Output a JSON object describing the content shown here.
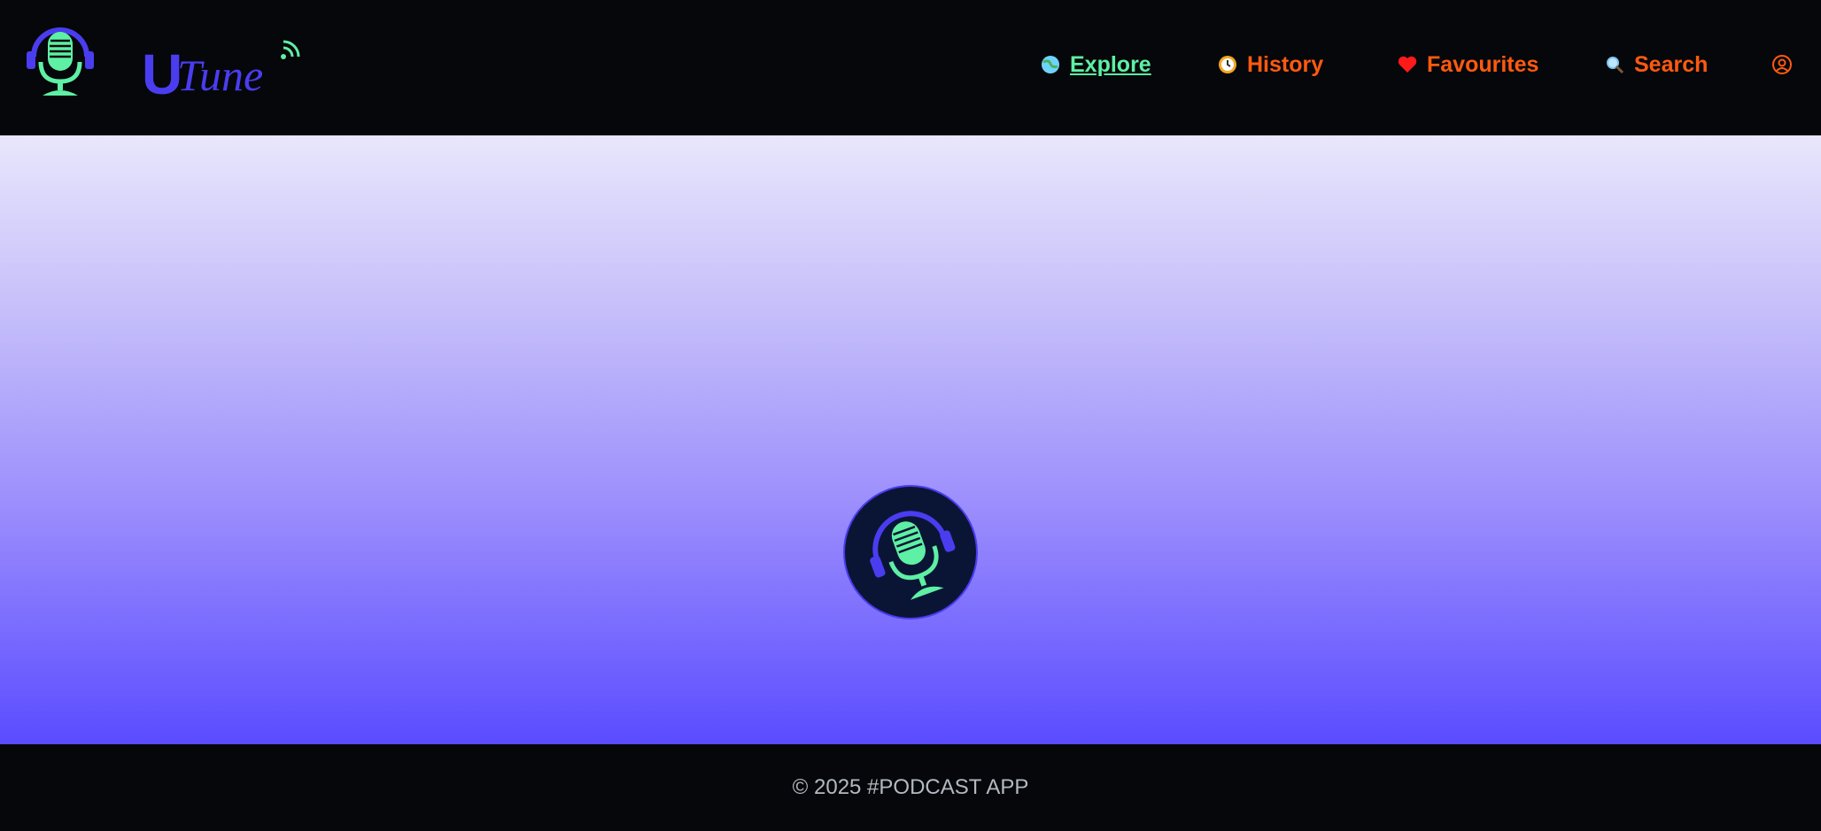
{
  "header": {
    "logo_icon": "podcast-mic-headphones-logo",
    "brand_icon": "utune-wordmark-logo",
    "brand_text": "UTune"
  },
  "nav": [
    {
      "label": "Explore",
      "icon": "globe-icon",
      "active": true,
      "color": "#5ef0a4"
    },
    {
      "label": "History",
      "icon": "clock-icon",
      "active": false,
      "color": "#ff5a10"
    },
    {
      "label": "Favourites",
      "icon": "heart-icon",
      "active": false,
      "color": "#ff5a10"
    },
    {
      "label": "Search",
      "icon": "magnifier-icon",
      "active": false,
      "color": "#ff5a10"
    },
    {
      "label": "",
      "icon": "user-circle-icon",
      "active": false,
      "color": "#ff5a10"
    }
  ],
  "main": {
    "loader_icon": "podcast-mic-headphones-logo"
  },
  "footer": {
    "text": "© 2025 #PODCAST APP"
  },
  "colors": {
    "accent_green": "#5ef0a4",
    "accent_orange": "#ff5a10",
    "brand_blue": "#4a3df0",
    "background": "#06070a"
  }
}
